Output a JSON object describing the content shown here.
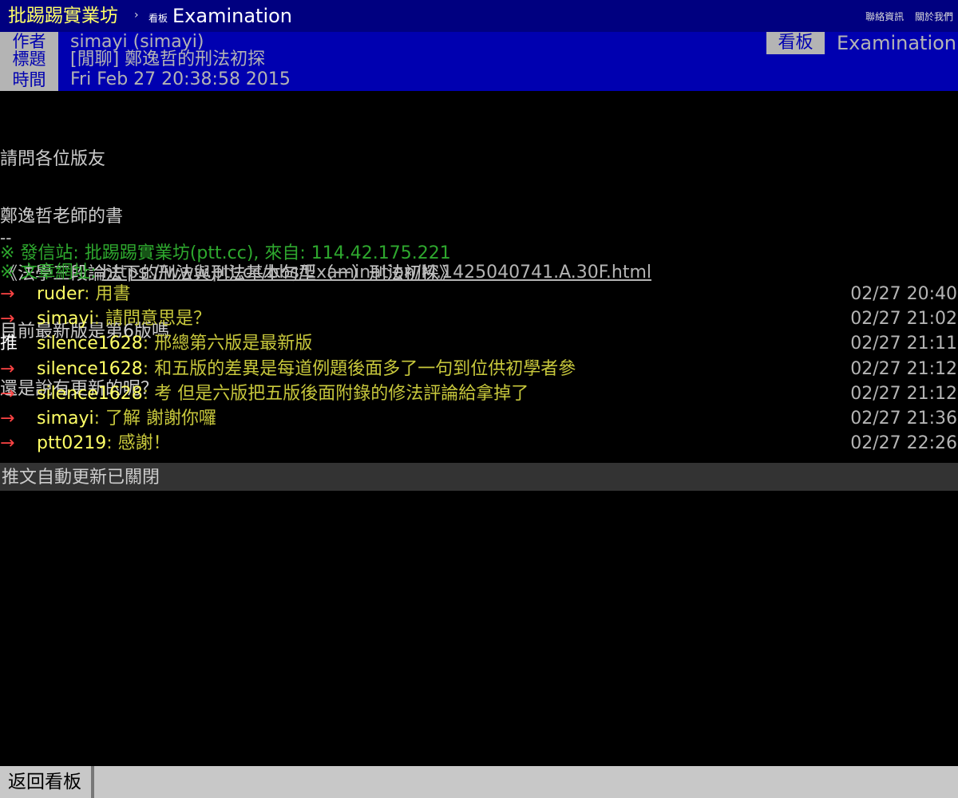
{
  "topbar": {
    "site_name": "批踢踢實業坊",
    "separator": "›",
    "board_label": "看板",
    "board_name": "Examination",
    "nav_links": [
      "聯絡資訊",
      "關於我們"
    ]
  },
  "meta": {
    "author_tag": "作者",
    "author": "simayi (simayi)",
    "title_tag": "標題",
    "title": "[閒聊] 鄭逸哲的刑法初探",
    "time_tag": "時間",
    "time": "Fri Feb 27 20:38:58 2015",
    "board_tag": "看板",
    "board": "Examination"
  },
  "content_lines": [
    "請問各位版友",
    "鄭逸哲老師的書",
    "《法學三段論法下的刑法與刑法基本句型（一）刑法初探》",
    "目前最新版是第6版嗎",
    "還是說有更新的呢？"
  ],
  "signature": {
    "separator": "--",
    "origin": "※ 發信站: 批踢踢實業坊(ptt.cc), 來自: 114.42.175.221",
    "url_prefix": "※ 文章網址: ",
    "url": "https://www.ptt.cc/bbs/Examination/M.1425040741.A.30F.html"
  },
  "pushes": [
    {
      "tag": "→",
      "user": "ruder",
      "content": ": 用書",
      "time": "02/27 20:40"
    },
    {
      "tag": "→",
      "user": "simayi",
      "content": ": 請問意思是？",
      "time": "02/27 21:02"
    },
    {
      "tag": "推",
      "user": "silence1628",
      "content": ": 邢總第六版是最新版",
      "time": "02/27 21:11"
    },
    {
      "tag": "→",
      "user": "silence1628",
      "content": ": 和五版的差異是每道例題後面多了一句到位供初學者參",
      "time": "02/27 21:12"
    },
    {
      "tag": "→",
      "user": "silence1628",
      "content": ": 考 但是六版把五版後面附錄的修法評論給拿掉了",
      "time": "02/27 21:12"
    },
    {
      "tag": "→",
      "user": "simayi",
      "content": ": 了解  謝謝你囉",
      "time": "02/27 21:36"
    },
    {
      "tag": "→",
      "user": "ptt0219",
      "content": ": 感謝！",
      "time": "02/27 22:26"
    }
  ],
  "auto_update_text": "推文自動更新已關閉",
  "bottombar": {
    "back_label": "返回看板"
  },
  "colors": {
    "nav_bg": "#000080",
    "meta_bg": "#0000b0",
    "meta_tag_bg": "#b4b4b4",
    "push_arrow": "#ff4444",
    "push_user": "#ffff66",
    "push_content": "#c8c83c",
    "origin": "#2ea82e"
  }
}
